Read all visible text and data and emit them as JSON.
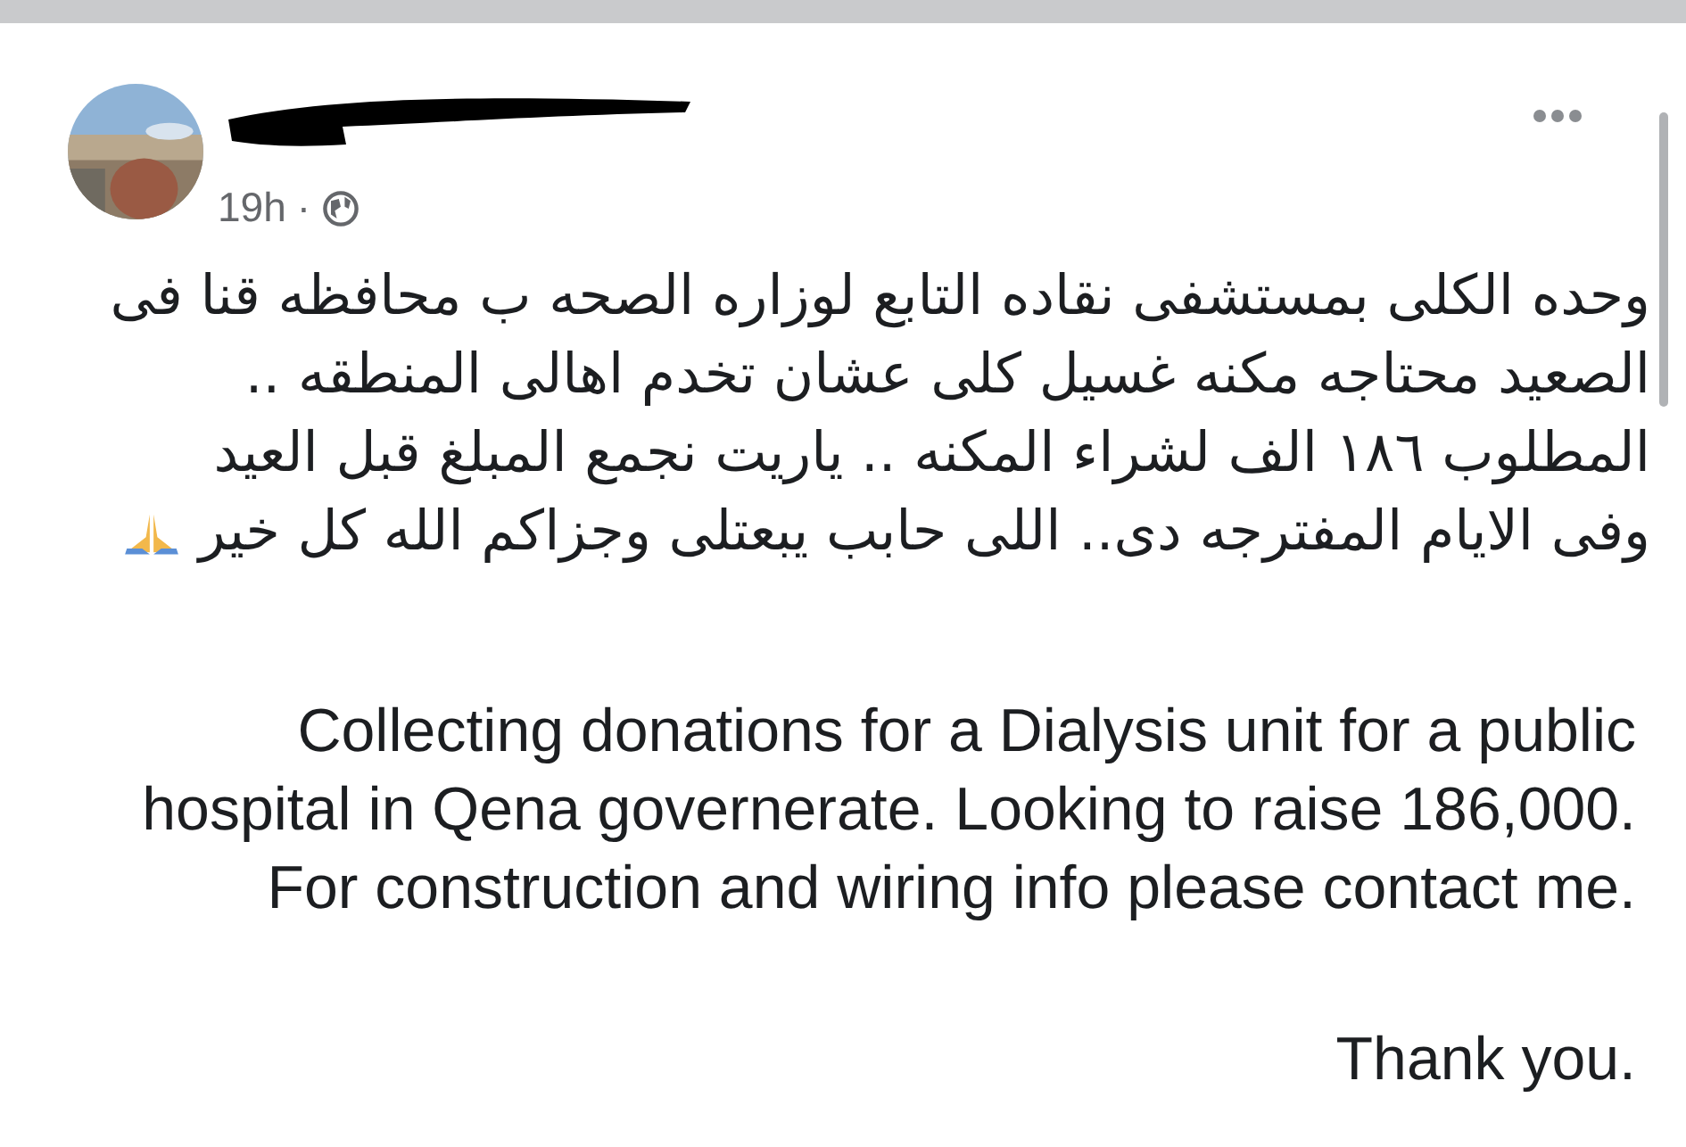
{
  "post": {
    "time": "19h",
    "separator": "·",
    "body_ar": "وحده الكلى بمستشفى نقاده التابع لوزاره الصحه ب محافظه قنا فى\nالصعيد محتاجه مكنه غسيل كلى عشان تخدم اهالى المنطقه ..\nالمطلوب ١٨٦ الف لشراء المكنه .. ياريت نجمع المبلغ قبل العيد\nوفى الايام المفترجه دى.. اللى حابب يبعتلى وجزاكم الله كل خير",
    "body_en": "Collecting donations for a Dialysis unit for a public\nhospital in Qena governerate. Looking to raise 186,000.\nFor construction and wiring info please contact me.",
    "closing": "Thank you."
  }
}
